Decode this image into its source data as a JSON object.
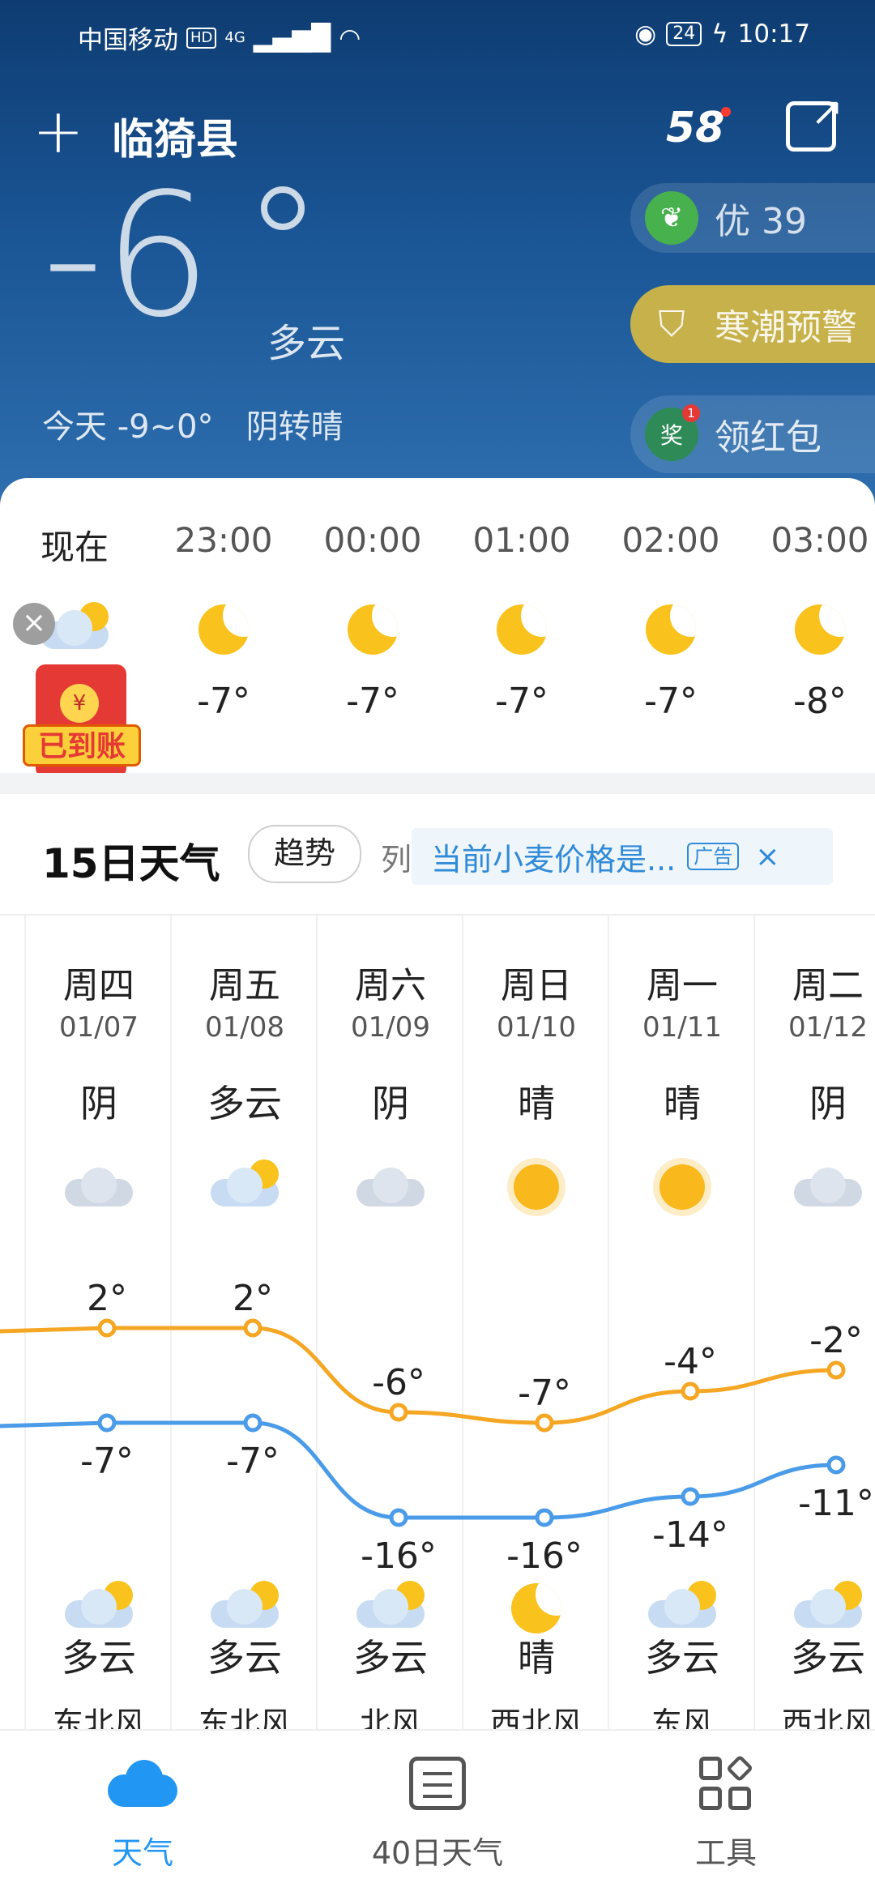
{
  "status_bar": {
    "carrier": "中国移动",
    "hd": "HD",
    "net": "4G",
    "battery": "24",
    "time": "10:17"
  },
  "header": {
    "add_icon": "plus-icon",
    "city": "临猗县",
    "badge": "58",
    "share_icon": "share-icon"
  },
  "current": {
    "temperature": "-6",
    "condition": "多云",
    "today_range": "今天 -9~0°",
    "today_desc": "阴转晴"
  },
  "side_pills": {
    "aqi": "优 39",
    "warning": "寒潮预警",
    "redpacket": "领红包",
    "redpacket_count": "1",
    "redpacket_glyph": "奖"
  },
  "hourly": [
    {
      "time": "现在",
      "icon": "cloudy-night-icon",
      "temp": ""
    },
    {
      "time": "23:00",
      "icon": "moon-icon",
      "temp": "-7°"
    },
    {
      "time": "00:00",
      "icon": "moon-icon",
      "temp": "-7°"
    },
    {
      "time": "01:00",
      "icon": "moon-icon",
      "temp": "-7°"
    },
    {
      "time": "02:00",
      "icon": "moon-icon",
      "temp": "-7°"
    },
    {
      "time": "03:00",
      "icon": "moon-icon",
      "temp": "-8°"
    }
  ],
  "red_packet": {
    "coin": "¥",
    "label": "已到账",
    "close": "×"
  },
  "fifteen": {
    "title": "15日天气",
    "trend_btn": "趋势",
    "list_btn": "列",
    "ad_text": "当前小麦价格是...",
    "ad_tag": "广告",
    "ad_close": "×"
  },
  "days": [
    {
      "week": "周四",
      "date": "01/07",
      "day_cond": "阴",
      "high": 2,
      "low": -7,
      "night_cond": "多云",
      "wind": "东北风"
    },
    {
      "week": "周五",
      "date": "01/08",
      "day_cond": "多云",
      "high": 2,
      "low": -7,
      "night_cond": "多云",
      "wind": "东北风"
    },
    {
      "week": "周六",
      "date": "01/09",
      "day_cond": "阴",
      "high": -6,
      "low": -16,
      "night_cond": "多云",
      "wind": "北风"
    },
    {
      "week": "周日",
      "date": "01/10",
      "day_cond": "晴",
      "high": -7,
      "low": -16,
      "night_cond": "晴",
      "wind": "西北风"
    },
    {
      "week": "周一",
      "date": "01/11",
      "day_cond": "晴",
      "high": -4,
      "low": -14,
      "night_cond": "多云",
      "wind": "东风"
    },
    {
      "week": "周二",
      "date": "01/12",
      "day_cond": "阴",
      "high": -2,
      "low": -11,
      "night_cond": "多云",
      "wind": "西北风"
    }
  ],
  "chart_data": {
    "type": "line",
    "categories": [
      "01/07",
      "01/08",
      "01/09",
      "01/10",
      "01/11",
      "01/12"
    ],
    "series": [
      {
        "values": [
          2,
          2,
          -6,
          -7,
          -4,
          -2
        ],
        "color": "#f5a623"
      },
      {
        "values": [
          -7,
          -7,
          -16,
          -16,
          -14,
          -11
        ],
        "color": "#4a9be8"
      }
    ]
  },
  "bottom_nav": [
    {
      "label": "天气",
      "icon": "weather-icon",
      "active": true
    },
    {
      "label": "40日天气",
      "icon": "calendar-icon",
      "active": false
    },
    {
      "label": "工具",
      "icon": "tools-icon",
      "active": false
    }
  ]
}
